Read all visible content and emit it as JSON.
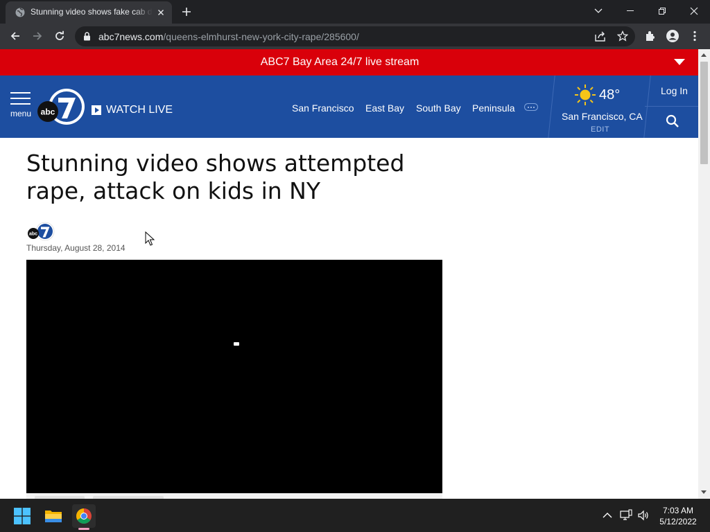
{
  "browser": {
    "tab_title": "Stunning video shows fake cab driver attempt rape, attack on kids in NY",
    "url_host": "abc7news.com",
    "url_path": "/queens-elmhurst-new-york-city-rape/285600/"
  },
  "site": {
    "live_banner": "ABC7 Bay Area 24/7 live stream",
    "menu_label": "menu",
    "watch_live": "WATCH LIVE",
    "nav_links": [
      "San Francisco",
      "East Bay",
      "South Bay",
      "Peninsula"
    ],
    "weather": {
      "temp": "48°",
      "city": "San Francisco, CA",
      "edit": "EDIT"
    },
    "login": "Log In",
    "colors": {
      "live_bar": "#d9000a",
      "nav_bg": "#1d4ea0"
    }
  },
  "article": {
    "headline": "Stunning video shows attempted rape, attack on kids in NY",
    "date": "Thursday, August 28, 2014"
  },
  "taskbar": {
    "time": "7:03 AM",
    "date": "5/12/2022"
  }
}
